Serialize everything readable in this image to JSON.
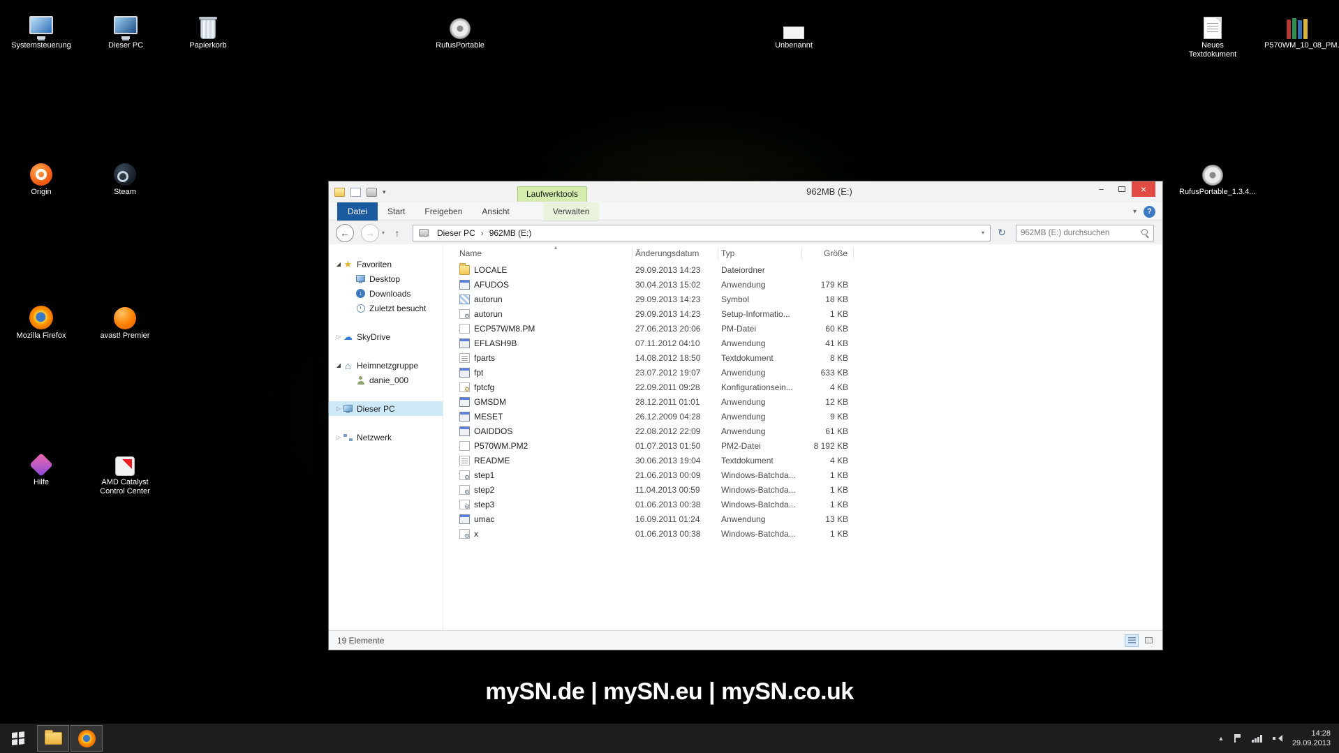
{
  "wallpaper": {
    "text": "mySN.de | mySN.eu | mySN.co.uk"
  },
  "desktop": {
    "icons": [
      {
        "label": "Systemsteuerung"
      },
      {
        "label": "Dieser PC"
      },
      {
        "label": "Papierkorb"
      },
      {
        "label": "RufusPortable"
      },
      {
        "label": "Unbenannt"
      },
      {
        "label": "Neues Textdokument"
      },
      {
        "label": "P570WM_10_08_PM..."
      },
      {
        "label": "Origin"
      },
      {
        "label": "Steam"
      },
      {
        "label": "Mozilla Firefox"
      },
      {
        "label": "avast! Premier"
      },
      {
        "label": "Hilfe"
      },
      {
        "label": "AMD Catalyst Control Center"
      },
      {
        "label": "RufusPortable_1.3.4..."
      }
    ]
  },
  "window": {
    "title": "962MB (E:)",
    "context_tab": "Laufwerktools",
    "tabs": [
      "Datei",
      "Start",
      "Freigeben",
      "Ansicht",
      "Verwalten"
    ],
    "breadcrumb": [
      "Dieser PC",
      "962MB (E:)"
    ],
    "search_placeholder": "962MB (E:) durchsuchen",
    "sidebar": {
      "favoriten": {
        "label": "Favoriten",
        "items": [
          "Desktop",
          "Downloads",
          "Zuletzt besucht"
        ]
      },
      "skydrive": "SkyDrive",
      "heimnetzgruppe": {
        "label": "Heimnetzgruppe",
        "items": [
          "danie_000"
        ]
      },
      "dieser_pc": "Dieser PC",
      "netzwerk": "Netzwerk"
    },
    "columns": [
      "Name",
      "Änderungsdatum",
      "Typ",
      "Größe"
    ],
    "files": [
      {
        "name": "LOCALE",
        "date": "29.09.2013 14:23",
        "type": "Dateiordner",
        "size": "",
        "icon": "folder"
      },
      {
        "name": "AFUDOS",
        "date": "30.04.2013 15:02",
        "type": "Anwendung",
        "size": "179 KB",
        "icon": "app"
      },
      {
        "name": "autorun",
        "date": "29.09.2013 14:23",
        "type": "Symbol",
        "size": "18 KB",
        "icon": "ico"
      },
      {
        "name": "autorun",
        "date": "29.09.2013 14:23",
        "type": "Setup-Informatio...",
        "size": "1 KB",
        "icon": "setup"
      },
      {
        "name": "ECP57WM8.PM",
        "date": "27.06.2013 20:06",
        "type": "PM-Datei",
        "size": "60 KB",
        "icon": "file"
      },
      {
        "name": "EFLASH9B",
        "date": "07.11.2012 04:10",
        "type": "Anwendung",
        "size": "41 KB",
        "icon": "app"
      },
      {
        "name": "fparts",
        "date": "14.08.2012 18:50",
        "type": "Textdokument",
        "size": "8 KB",
        "icon": "text"
      },
      {
        "name": "fpt",
        "date": "23.07.2012 19:07",
        "type": "Anwendung",
        "size": "633 KB",
        "icon": "app"
      },
      {
        "name": "fptcfg",
        "date": "22.09.2011 09:28",
        "type": "Konfigurationsein...",
        "size": "4 KB",
        "icon": "config"
      },
      {
        "name": "GMSDM",
        "date": "28.12.2011 01:01",
        "type": "Anwendung",
        "size": "12 KB",
        "icon": "app"
      },
      {
        "name": "MESET",
        "date": "26.12.2009 04:28",
        "type": "Anwendung",
        "size": "9 KB",
        "icon": "app"
      },
      {
        "name": "OAIDDOS",
        "date": "22.08.2012 22:09",
        "type": "Anwendung",
        "size": "61 KB",
        "icon": "app"
      },
      {
        "name": "P570WM.PM2",
        "date": "01.07.2013 01:50",
        "type": "PM2-Datei",
        "size": "8 192 KB",
        "icon": "file"
      },
      {
        "name": "README",
        "date": "30.06.2013 19:04",
        "type": "Textdokument",
        "size": "4 KB",
        "icon": "text"
      },
      {
        "name": "step1",
        "date": "21.06.2013 00:09",
        "type": "Windows-Batchda...",
        "size": "1 KB",
        "icon": "batch"
      },
      {
        "name": "step2",
        "date": "11.04.2013 00:59",
        "type": "Windows-Batchda...",
        "size": "1 KB",
        "icon": "batch"
      },
      {
        "name": "step3",
        "date": "01.06.2013 00:38",
        "type": "Windows-Batchda...",
        "size": "1 KB",
        "icon": "batch"
      },
      {
        "name": "umac",
        "date": "16.09.2011 01:24",
        "type": "Anwendung",
        "size": "13 KB",
        "icon": "app"
      },
      {
        "name": "x",
        "date": "01.06.2013 00:38",
        "type": "Windows-Batchda...",
        "size": "1 KB",
        "icon": "batch"
      }
    ],
    "status_text": "19 Elemente"
  },
  "taskbar": {
    "time": "14:28",
    "date": "29.09.2013"
  }
}
